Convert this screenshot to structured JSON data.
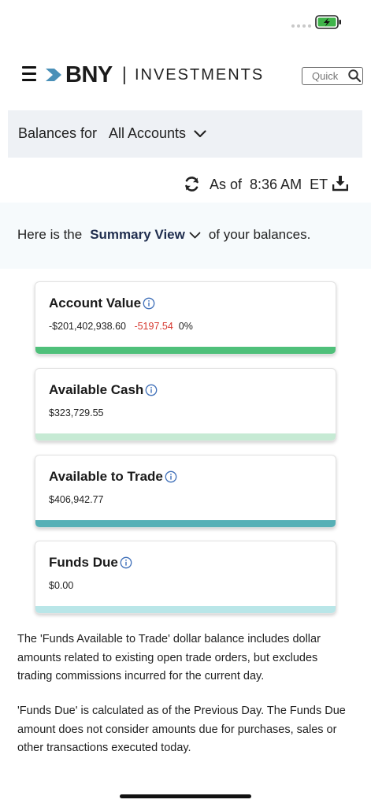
{
  "status_bar": {
    "battery_state": "charging",
    "battery_color": "#3fb44a"
  },
  "header": {
    "logo_mark": "BNY",
    "logo_separator": "|",
    "logo_product": "INVESTMENTS",
    "search_placeholder": "Quick"
  },
  "balances": {
    "label": "Balances for",
    "account_selected": "All Accounts"
  },
  "as_of": {
    "text": "As of  8:36 AM  ET"
  },
  "summary": {
    "prefix": "Here is the",
    "view": "Summary View",
    "suffix": "of your balances."
  },
  "cards": [
    {
      "title": "Account Value",
      "value": "-$201,402,938.60",
      "change": "-5197.54",
      "percent": "0%",
      "bar_color": "#4fc07a"
    },
    {
      "title": "Available Cash",
      "value": "$323,729.55",
      "bar_color": "#c6ead4"
    },
    {
      "title": "Available to Trade",
      "value": "$406,942.77",
      "bar_color": "#56b0b6"
    },
    {
      "title": "Funds Due",
      "value": "$0.00",
      "bar_color": "#b9e6e8"
    }
  ],
  "notes": [
    "The 'Funds Available to Trade' dollar balance includes dollar amounts related to existing open trade orders, but excludes trading commissions incurred for the current day.",
    "'Funds Due' is calculated as of the Previous Day. The Funds Due amount does not consider amounts due for purchases, sales or other transactions executed today."
  ],
  "colors": {
    "brand_arrow": "#4a90b8",
    "info_icon": "#3f6fb8",
    "negative": "#d6372e",
    "summary_view": "#1f2d4e"
  },
  "icons": [
    "menu-icon",
    "bny-arrow-icon",
    "search-icon",
    "chevron-down-icon",
    "refresh-icon",
    "download-icon",
    "info-icon",
    "battery-charging-icon"
  ]
}
